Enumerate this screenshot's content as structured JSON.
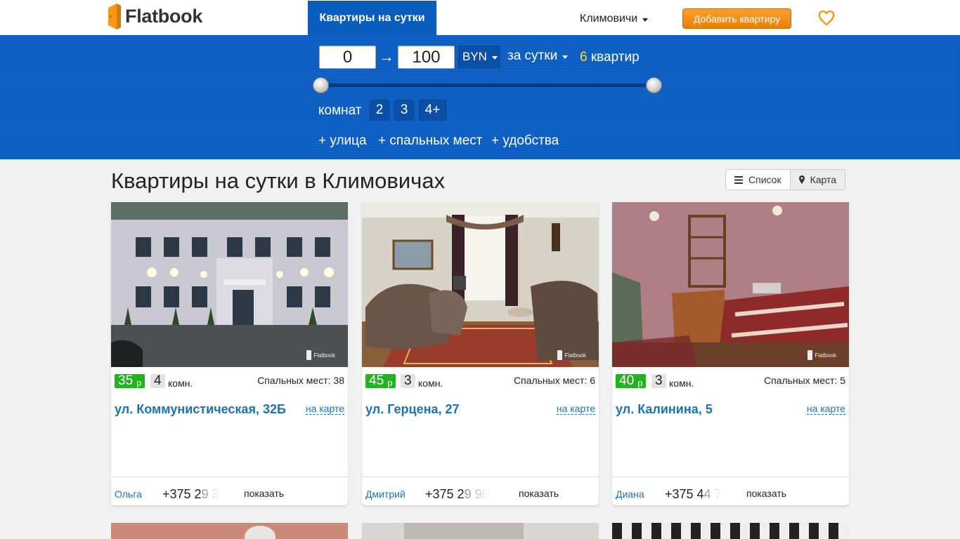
{
  "header": {
    "logo_text": "Flatbook",
    "nav_active": "Квартиры на сутки",
    "city": "Климовичи",
    "add_button": "Добавить квартиру"
  },
  "filter": {
    "price_min": "0",
    "arrow": "→",
    "price_max": "100",
    "currency": "BYN",
    "period": "за сутки",
    "count_num": "6",
    "count_label": "квартир",
    "slider_min_fraction": 0,
    "slider_max_fraction": 1,
    "rooms_label": "комнат",
    "room_options": [
      "2",
      "3",
      "4+"
    ],
    "extras": [
      "+ улица",
      "+ спальных мест",
      "+ удобства"
    ]
  },
  "page": {
    "title": "Квартиры на сутки в Климовичах",
    "view_list": "Список",
    "view_map": "Карта"
  },
  "listings": [
    {
      "price": "35",
      "price_unit": "р",
      "rooms": "4",
      "rooms_unit": "комн.",
      "beds": "Спальных мест: 38",
      "street": "ул. Коммунистическая, 32Б",
      "on_map": "на карте",
      "owner": "Ольга",
      "phone_visible": "+375 2",
      "phone_faded": "9 3",
      "show": "показать",
      "watermark": "Flatbook"
    },
    {
      "price": "45",
      "price_unit": "р",
      "rooms": "3",
      "rooms_unit": "комн.",
      "beds": "Спальных мест: 6",
      "street": "ул. Герцена, 27",
      "on_map": "на карте",
      "owner": "Дмитрий",
      "phone_visible": "+375 2",
      "phone_faded": "9 90",
      "show": "показать",
      "watermark": "Flatbook"
    },
    {
      "price": "40",
      "price_unit": "р",
      "rooms": "3",
      "rooms_unit": "комн.",
      "beds": "Спальных мест: 5",
      "street": "ул. Калинина, 5",
      "on_map": "на карте",
      "owner": "Диана",
      "phone_visible": "+375 4",
      "phone_faded": "4 7",
      "show": "показать",
      "watermark": "Flatbook"
    }
  ],
  "colors": {
    "brand_blue": "#0c5ec2",
    "price_green": "#22b420",
    "add_orange": "#ec8006",
    "link_blue": "#1a73b8"
  }
}
